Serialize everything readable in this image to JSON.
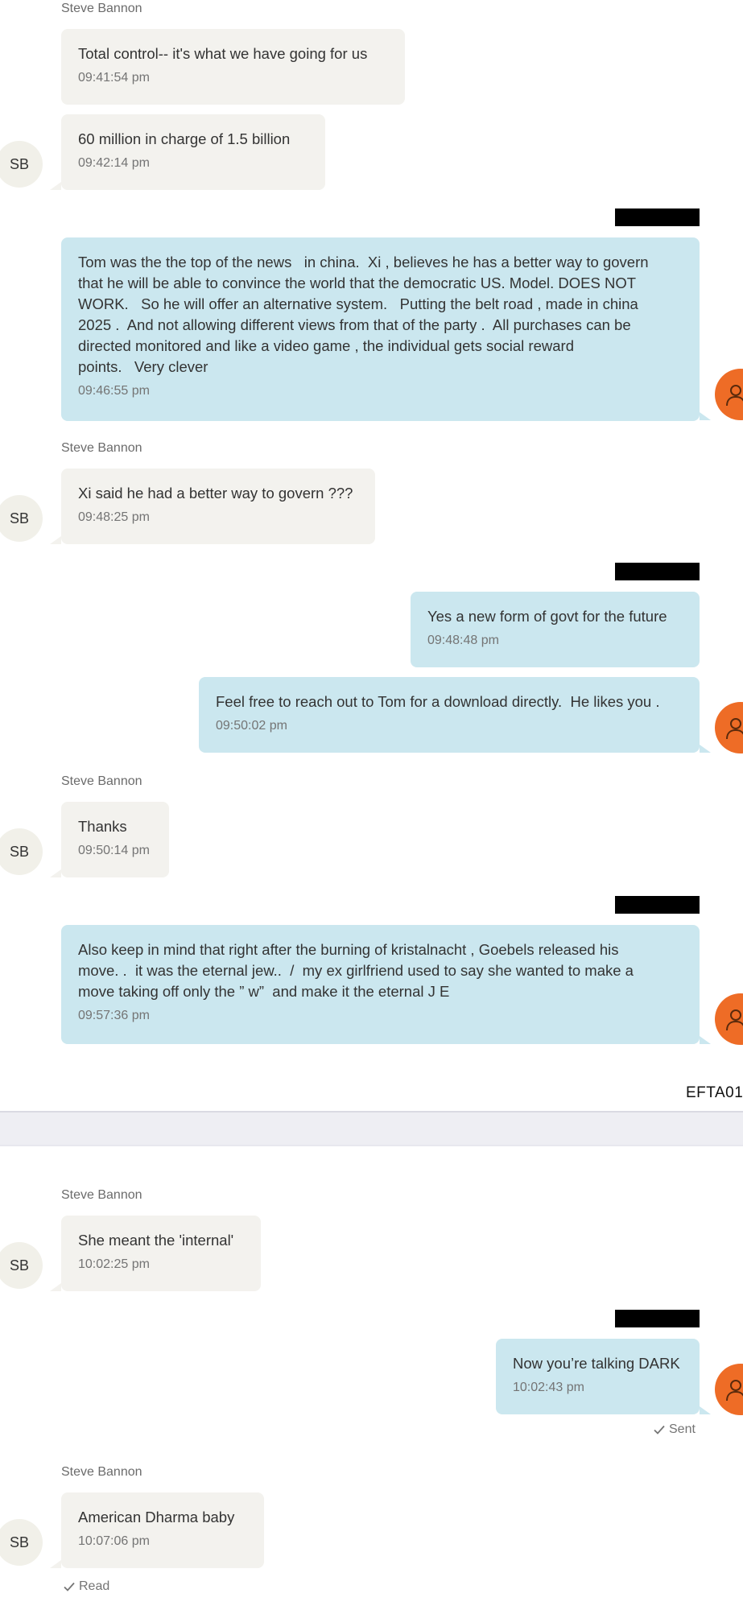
{
  "contact": {
    "name": "Steve Bannon",
    "initials": "SB"
  },
  "doc_id": "EFTA01",
  "messages": [
    {
      "sender": "Steve Bannon",
      "text": "Total control-- it's what we have going for us",
      "time": "09:41:54 pm"
    },
    {
      "text": "60 million in charge of 1.5 billion",
      "time": "09:42:14 pm"
    },
    {
      "text": "Tom was the the top of the news   in china.  Xi , believes he has a better way to govern\nthat he will be able to convince the world that the democratic US. Model. DOES NOT\nWORK.   So he will offer an alternative system.   Putting the belt road , made in china\n2025 .  And not allowing different views from that of the party .  All purchases can be\ndirected monitored and like a video game , the individual gets social reward\npoints.   Very clever",
      "time": "09:46:55 pm"
    },
    {
      "sender": "Steve Bannon",
      "text": "Xi said he had a better way to govern ???",
      "time": "09:48:25 pm"
    },
    {
      "text": "Yes a new form of govt for the future",
      "time": "09:48:48 pm"
    },
    {
      "text": "Feel free to reach out to Tom for a download directly.  He likes you .",
      "time": "09:50:02 pm"
    },
    {
      "sender": "Steve Bannon",
      "text": "Thanks",
      "time": "09:50:14 pm"
    },
    {
      "text": "Also keep in mind that right after the burning of kristalnacht , Goebels released his\nmove. .  it was the eternal jew..  /  my ex girlfriend used to say she wanted to make a\nmove taking off only the ” w”  and make it the eternal J E",
      "time": "09:57:36 pm"
    },
    {
      "sender": "Steve Bannon",
      "text": "She meant the 'internal'",
      "time": "10:02:25 pm"
    },
    {
      "text": "Now you’re talking DARK",
      "time": "10:02:43 pm",
      "status": "Sent"
    },
    {
      "sender": "Steve Bannon",
      "text": "American Dharma baby",
      "time": "10:07:06 pm",
      "status": "Read"
    }
  ],
  "colors": {
    "incoming_bubble": "#f3f2ee",
    "outgoing_bubble": "#cbe7ef",
    "own_avatar": "#ee6c26",
    "redaction": "#000000"
  },
  "icons": {
    "own_avatar": "person-icon",
    "status": "check-icon"
  }
}
